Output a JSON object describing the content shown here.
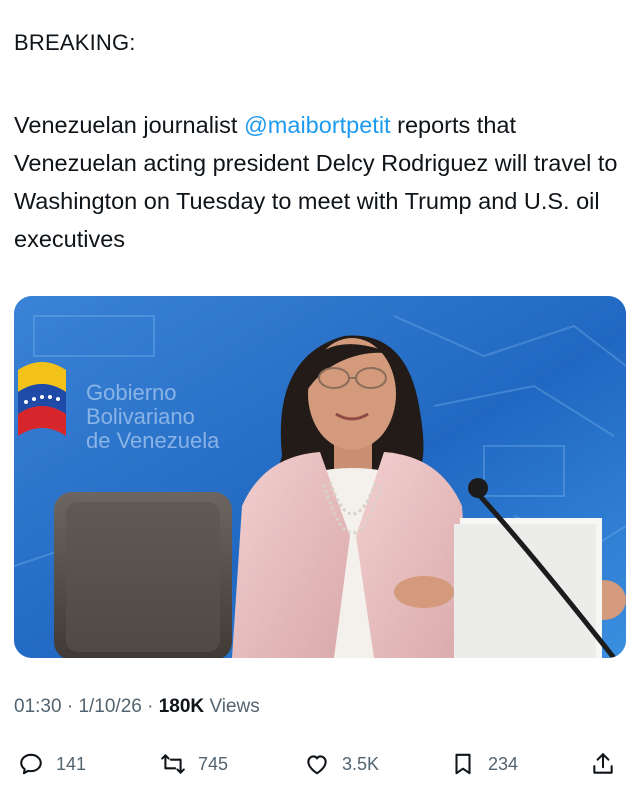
{
  "tweet": {
    "heading": "BREAKING:",
    "text_before": "Venezuelan journalist ",
    "mention": "@maibortpetit",
    "text_after": " reports that Venezuelan acting president Delcy Rodriguez will travel to Washington on Tuesday to meet with Trump and U.S. oil executives"
  },
  "media": {
    "backdrop_text_line1": "Gobierno",
    "backdrop_text_line2": "Bolivariano",
    "backdrop_text_line3": "de Venezuela"
  },
  "meta": {
    "time": "01:30",
    "separator": "·",
    "date": "1/10/26",
    "views_count": "180K",
    "views_label": "Views"
  },
  "actions": {
    "replies": "141",
    "reposts": "745",
    "likes": "3.5K",
    "bookmarks": "234"
  },
  "colors": {
    "accent": "#1d9bf0",
    "text": "#0f1419",
    "muted": "#536471"
  },
  "icons": [
    "reply-icon",
    "repost-icon",
    "like-icon",
    "bookmark-icon",
    "share-icon"
  ]
}
